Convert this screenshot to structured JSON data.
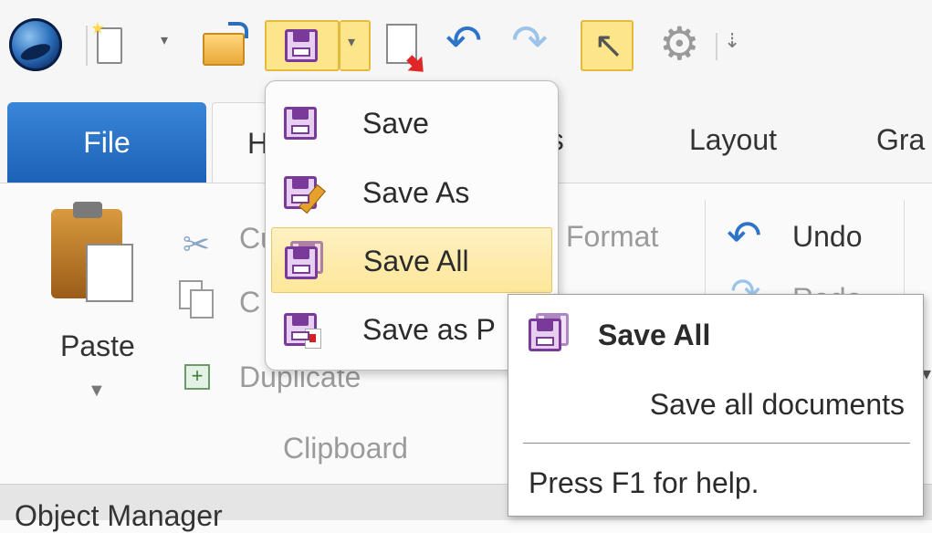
{
  "quick_access": {
    "icons": [
      "app-logo-icon",
      "new-document-icon",
      "open-folder-icon",
      "save-icon",
      "export-icon",
      "undo-icon",
      "redo-icon",
      "pointer-icon",
      "gear-icon",
      "customize-toolbar-icon"
    ],
    "dropdown_caret": "▾",
    "undo_glyph": "↶",
    "redo_glyph": "↷",
    "pointer_glyph": "↖",
    "gear_glyph": "⚙",
    "customize_glyph": "⇣"
  },
  "tabs": [
    "File",
    "H",
    "es",
    "Layout",
    "Gra"
  ],
  "clipboard_group": {
    "paste_label": "Paste",
    "paste_arrow": "▼",
    "cut_label": "Cu",
    "copy_label": "C",
    "duplicate_label": "Duplicate",
    "format_label": "Format",
    "group_label": "Clipboard"
  },
  "edit_group": {
    "undo_label": "Undo",
    "redo_label": "Redo",
    "undo_glyph": "↶",
    "redo_glyph": "↷"
  },
  "scroll_indicator": "▾",
  "object_manager_label": "Object Manager",
  "save_menu": {
    "items": [
      {
        "label": "Save",
        "icon": "floppy-icon"
      },
      {
        "label": "Save As",
        "icon": "floppy-pencil-icon"
      },
      {
        "label": "Save All",
        "icon": "floppy-stack-icon",
        "highlighted": true
      },
      {
        "label": "Save as P",
        "icon": "floppy-pdf-icon"
      }
    ]
  },
  "tooltip": {
    "title": "Save All",
    "description": "Save all documents",
    "help": "Press F1 for help."
  },
  "colors": {
    "accent_file_tab": "#1c61b6",
    "highlight": "#fde79a",
    "floppy": "#7a3a9a"
  }
}
